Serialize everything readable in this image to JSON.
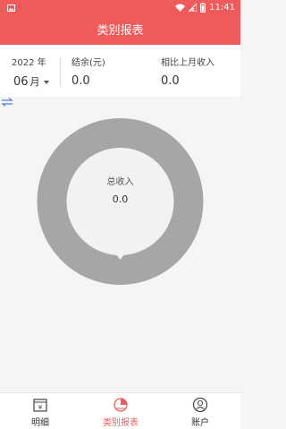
{
  "status_bar": {
    "time": "11:41"
  },
  "app_bar": {
    "title": "类别报表"
  },
  "summary": {
    "year": "2022 年",
    "month_number": "06",
    "month_suffix": "月",
    "balance_label": "结余(元)",
    "balance_value": "0.0",
    "compare_label": "相比上月收入",
    "compare_value": "0.0"
  },
  "chart": {
    "center_title": "总收入",
    "center_value": "0.0",
    "ring_color": "#a6a6a6",
    "inner_color": "#f2f2f5"
  },
  "tabs": [
    {
      "label": "明细",
      "icon": "yuan-ledger-icon",
      "active": false
    },
    {
      "label": "类别报表",
      "icon": "pie-chart-icon",
      "active": true
    },
    {
      "label": "账户",
      "icon": "user-account-icon",
      "active": false
    }
  ],
  "colors": {
    "accent": "#ef5b5b",
    "swap_icon": "#4a7fe0"
  }
}
